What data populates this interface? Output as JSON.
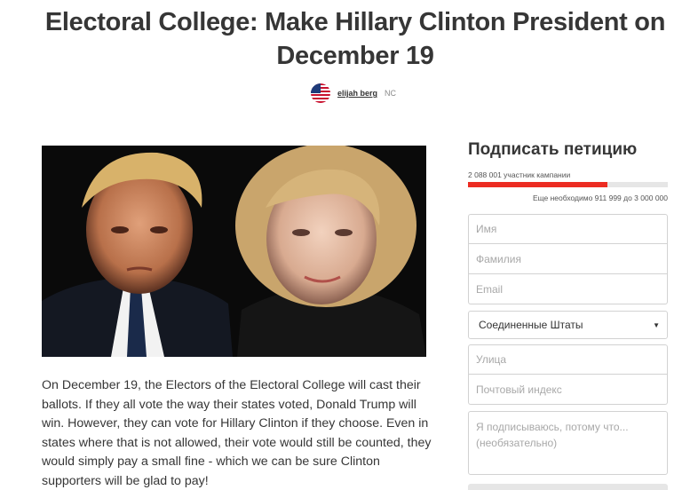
{
  "petition": {
    "title": "Electoral College: Make Hillary Clinton President on December 19",
    "author": "elijah berg",
    "location": "NC",
    "description": "On December 19, the Electors of the Electoral College will cast their ballots. If they all vote the way their states voted, Donald Trump will win. However, they can vote for Hillary Clinton if they choose. Even in states where that is not allowed, their vote would still be counted, they would simply pay a small fine - which we can be sure Clinton supporters will be glad to pay!"
  },
  "sign": {
    "heading": "Подписать петицию",
    "supporters_text": "2 088 001 участник кампании",
    "progress_fraction": 0.696,
    "needed_text": "Еще необходимо 911 999 до 3 000 000",
    "first_name_placeholder": "Имя",
    "last_name_placeholder": "Фамилия",
    "email_placeholder": "Email",
    "country_selected": "Соединенные Штаты",
    "street_placeholder": "Улица",
    "zip_placeholder": "Почтовый индекс",
    "reason_placeholder": "Я подписываюсь, потому что... (необязательно)"
  },
  "colors": {
    "accent": "#ec2c22",
    "text": "#363636",
    "border": "#d2d2d2"
  },
  "icons": {
    "avatar": "us-flag-avatar",
    "select_caret": "caret-down-icon"
  }
}
